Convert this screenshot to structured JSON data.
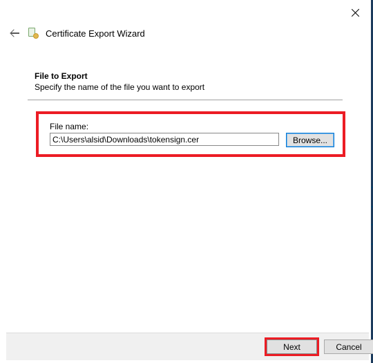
{
  "window": {
    "title": "Certificate Export Wizard",
    "close_alt": "Close"
  },
  "section": {
    "heading": "File to Export",
    "subtext": "Specify the name of the file you want to export"
  },
  "form": {
    "filename_label": "File name:",
    "filename_value": "C:\\Users\\alsid\\Downloads\\tokensign.cer",
    "browse_label": "Browse..."
  },
  "footer": {
    "next_label": "Next",
    "cancel_label": "Cancel"
  }
}
